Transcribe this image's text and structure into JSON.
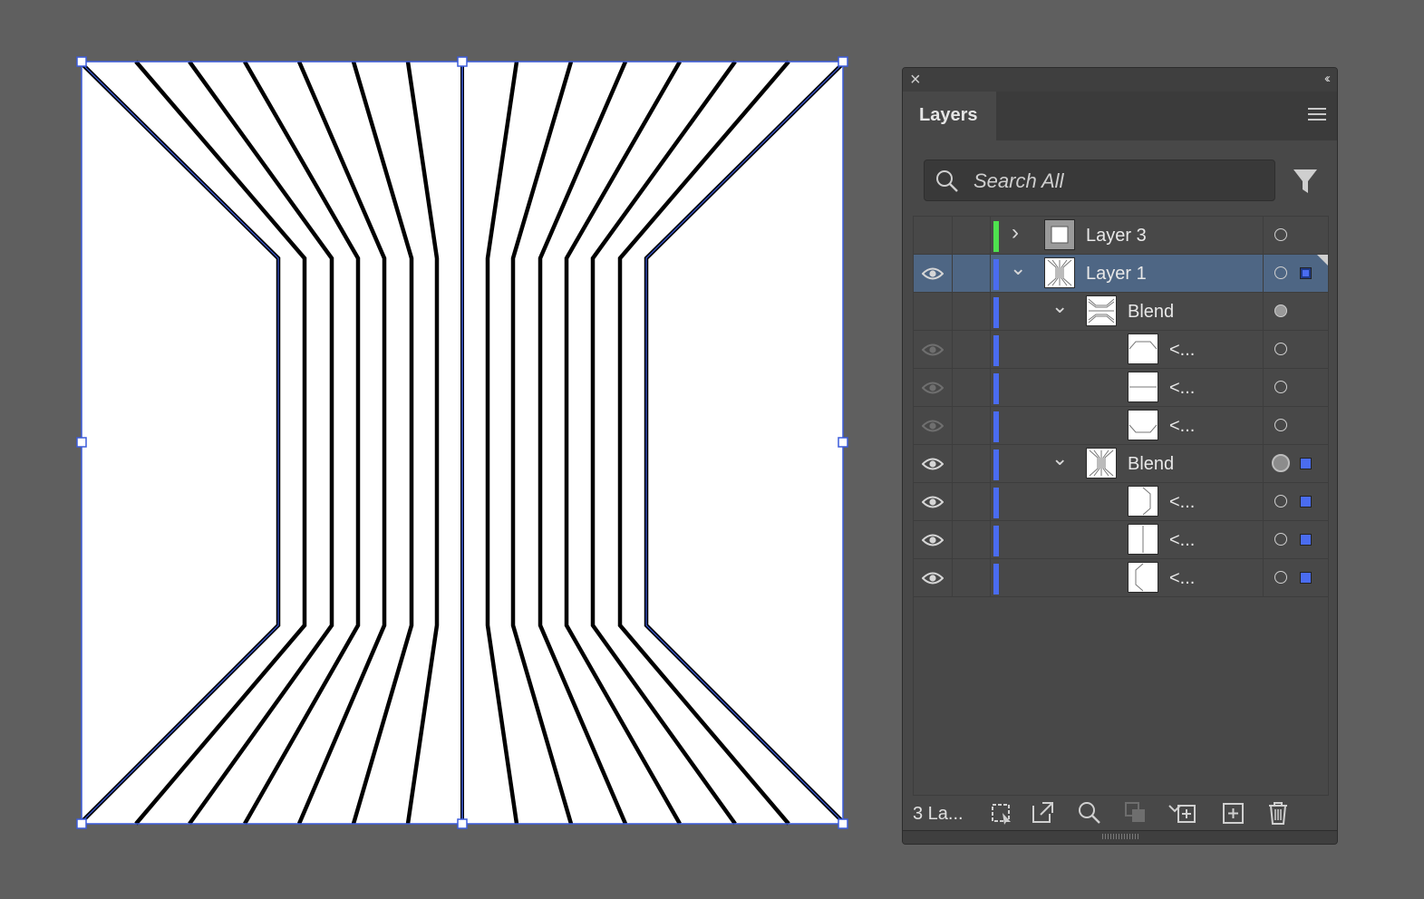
{
  "canvas": {
    "background_color": "#5f5f5f",
    "artboard_color": "#ffffff",
    "selection_color": "#3b5bdb"
  },
  "layers_panel": {
    "tab_label": "Layers",
    "close_icon": "close-icon",
    "collapse_icon": "collapse-panel-icon",
    "menu_icon": "panel-menu-icon",
    "search": {
      "placeholder": "Search All",
      "value": ""
    },
    "filter_icon": "filter-icon",
    "rows": [
      {
        "name": "Layer 3",
        "visible": false,
        "color": "#4ee24e",
        "expanded": false,
        "selected": false,
        "indent": 0,
        "target": "hollow",
        "selection": "none",
        "thumb": "layer3"
      },
      {
        "name": "Layer 1",
        "visible": true,
        "color": "#4a6cf0",
        "expanded": true,
        "selected": true,
        "indent": 0,
        "target": "hollow",
        "selection": "partial",
        "thumb": "layer1"
      },
      {
        "name": "Blend",
        "visible": false,
        "color": "#4a6cf0",
        "expanded": true,
        "selected": false,
        "indent": 1,
        "target": "filled",
        "selection": "none",
        "thumb": "blendA"
      },
      {
        "name": "<...",
        "visible": "dim",
        "color": "#4a6cf0",
        "indent": 2,
        "target": "hollow",
        "selection": "none",
        "thumb": "path1"
      },
      {
        "name": "<...",
        "visible": "dim",
        "color": "#4a6cf0",
        "indent": 2,
        "target": "hollow",
        "selection": "none",
        "thumb": "path2"
      },
      {
        "name": "<...",
        "visible": "dim",
        "color": "#4a6cf0",
        "indent": 2,
        "target": "hollow",
        "selection": "none",
        "thumb": "path3"
      },
      {
        "name": "Blend",
        "visible": true,
        "color": "#4a6cf0",
        "expanded": true,
        "selected": false,
        "indent": 1,
        "target": "big",
        "selection": "full",
        "thumb": "blendB"
      },
      {
        "name": "<...",
        "visible": true,
        "color": "#4a6cf0",
        "indent": 2,
        "target": "hollow",
        "selection": "full",
        "thumb": "path4"
      },
      {
        "name": "<...",
        "visible": true,
        "color": "#4a6cf0",
        "indent": 2,
        "target": "hollow",
        "selection": "full",
        "thumb": "path5"
      },
      {
        "name": "<...",
        "visible": true,
        "color": "#4a6cf0",
        "indent": 2,
        "target": "hollow",
        "selection": "full",
        "thumb": "path6"
      }
    ],
    "footer": {
      "layer_count": "3 La...",
      "icons": [
        "collect-for-export-icon",
        "export-icon",
        "locate-object-icon",
        "make-clipping-mask-icon",
        "create-sublayer-icon",
        "new-layer-icon",
        "delete-icon"
      ]
    }
  }
}
